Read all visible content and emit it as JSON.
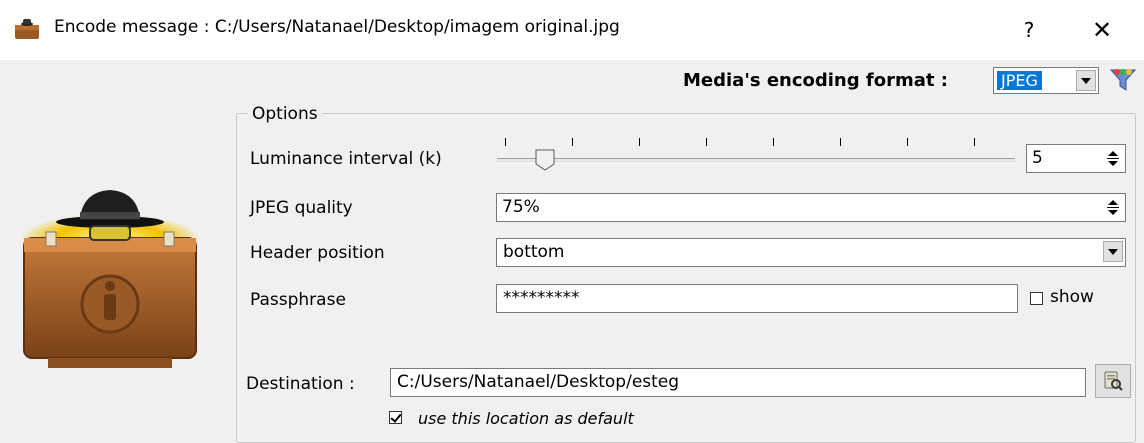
{
  "window": {
    "title": "Encode message : C:/Users/Natanael/Desktop/imagem original.jpg",
    "help_label": "?",
    "close_label": "✕",
    "app_icon": "briefcase-icon"
  },
  "format": {
    "label": "Media's encoding format :",
    "selected": "JPEG",
    "filter_icon": "filter-icon"
  },
  "options": {
    "legend": "Options",
    "luminance": {
      "label": "Luminance interval (k)",
      "value": "5"
    },
    "jpeg_quality": {
      "label": "JPEG quality",
      "value": "75%"
    },
    "header_position": {
      "label": "Header position",
      "value": "bottom"
    },
    "passphrase": {
      "label": "Passphrase",
      "value": "*********",
      "show_label": "show",
      "show_checked": false
    }
  },
  "destination": {
    "label": "Destination :",
    "path": "C:/Users/Natanael/Desktop/esteg",
    "default_label": "use this location as default",
    "default_checked": true,
    "browse_icon": "browse-folder-icon"
  },
  "illustration": "spy-briefcase-icon",
  "colors": {
    "selection": "#0078d7",
    "background": "#f0f0f0"
  }
}
